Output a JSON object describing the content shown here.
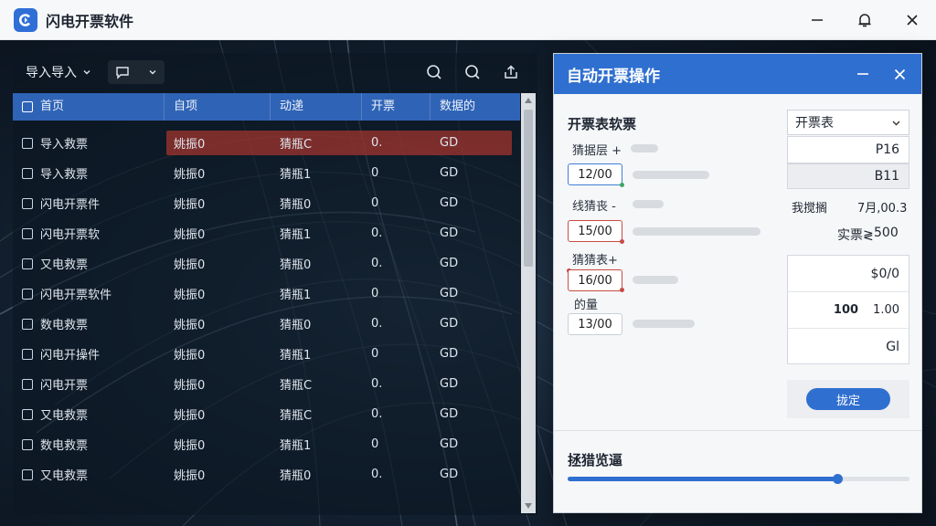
{
  "app": {
    "title": "闪电开票软件"
  },
  "toolbar": {
    "import_label": "导入导入"
  },
  "table": {
    "headers": [
      "首页",
      "自项",
      "动递",
      "开票",
      "数据的"
    ],
    "rows": [
      {
        "name": "导入救票",
        "c2": "姚振0",
        "c3": "猜瓶C",
        "c4": "0.",
        "c5": "GD"
      },
      {
        "name": "导入救票",
        "c2": "姚振0",
        "c3": "猜瓶1",
        "c4": "0",
        "c5": "GD"
      },
      {
        "name": "闪电开票件",
        "c2": "姚振0",
        "c3": "猜瓶0",
        "c4": "0",
        "c5": "GD"
      },
      {
        "name": "闪电开票软",
        "c2": "姚振0",
        "c3": "猜瓶1",
        "c4": "0.",
        "c5": "GD"
      },
      {
        "name": "又电救票",
        "c2": "姚振0",
        "c3": "猜瓶0",
        "c4": "0.",
        "c5": "GD"
      },
      {
        "name": "闪电开票软件",
        "c2": "姚振0",
        "c3": "猜瓶1",
        "c4": "0",
        "c5": "GD"
      },
      {
        "name": "数电救票",
        "c2": "姚振0",
        "c3": "猜瓶0",
        "c4": "0.",
        "c5": "GD"
      },
      {
        "name": "闪电开操件",
        "c2": "姚振0",
        "c3": "猜瓶1",
        "c4": "0",
        "c5": "GD"
      },
      {
        "name": "闪电开票",
        "c2": "姚振0",
        "c3": "猜瓶C",
        "c4": "0.",
        "c5": "GD"
      },
      {
        "name": "又电救票",
        "c2": "姚振0",
        "c3": "猜瓶C",
        "c4": "0.",
        "c5": "GD"
      },
      {
        "name": "数电救票",
        "c2": "姚振0",
        "c3": "猜瓶1",
        "c4": "0",
        "c5": "GD"
      },
      {
        "name": "又电救票",
        "c2": "姚振0",
        "c3": "猜瓶0",
        "c4": "0.",
        "c5": "GD"
      }
    ]
  },
  "dialog": {
    "title": "自动开票操作",
    "form_title": "开票表软票",
    "label_1": "猜据层 +",
    "input_1": "12/00",
    "label_2": "线猜丧 -",
    "input_2": "15/00",
    "label_3": "猜猜表+",
    "input_3": "16/00",
    "label_4": "的量",
    "input_4": "13/00",
    "select_value": "开票表",
    "box_1": "P16",
    "box_2": "B11",
    "kv1_key": "我搅搁",
    "kv1_value": "7月,00.3",
    "kv2_key": "实票≷",
    "kv2_value": "500",
    "sum_1": "$0/0",
    "sum_2a": "100",
    "sum_2b": "1.00",
    "sum_3": "Gl",
    "confirm_label": "拢定",
    "progress_label": "拯猎览逼",
    "progress_value": 0.79
  },
  "colors": {
    "accent": "#2f6fd0",
    "header_blue": "#2f63b6",
    "highlight_red": "#a6342e"
  }
}
